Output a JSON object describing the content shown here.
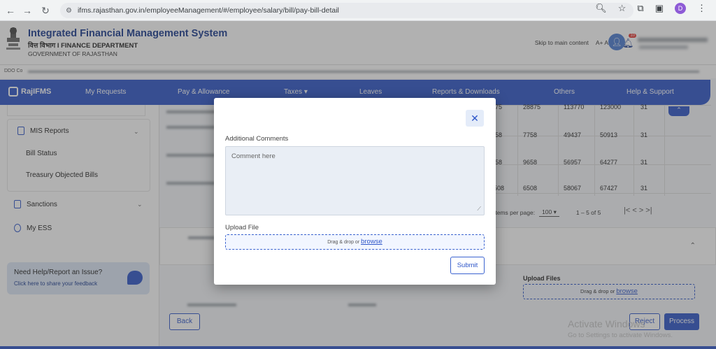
{
  "browser": {
    "url": "ifms.rajasthan.gov.in/employeeManagement/#/employee/salary/bill/pay-bill-detail",
    "profile_initial": "D"
  },
  "header": {
    "title": "Integrated Financial Management System",
    "department": "वित्त विभाग  I  FINANCE DEPARTMENT",
    "government": "GOVERNMENT OF RAJASTHAN",
    "skip_link": "Skip to main content",
    "font_controls": "A+  A  A-",
    "notification_count": "10",
    "ddo_label": "DDO Co"
  },
  "navbar": {
    "brand": "RajIFMS",
    "items": [
      "My Requests",
      "Pay & Allowance",
      "Taxes ▾",
      "Leaves",
      "Reports & Downloads",
      "Others",
      "Help & Support"
    ]
  },
  "sidebar": {
    "mis_reports": "MIS Reports",
    "bill_status": "Bill Status",
    "treasury_objected": "Treasury Objected Bills",
    "sanctions": "Sanctions",
    "my_ess": "My ESS",
    "help_title": "Need Help/Report an Issue?",
    "help_link": "Click here to share your feedback"
  },
  "table": {
    "rows": [
      [
        "75",
        "28875",
        "113770",
        "123000",
        "31"
      ],
      [
        "58",
        "7758",
        "49437",
        "50913",
        "31"
      ],
      [
        "58",
        "9658",
        "56957",
        "64277",
        "31"
      ],
      [
        "508",
        "6508",
        "58067",
        "67427",
        "31"
      ]
    ],
    "per_page_label": "Items per page:",
    "per_page_value": "100",
    "range": "1 – 5 of 5",
    "pager_icons": "|<   <   >   >|"
  },
  "main": {
    "upload_files_label": "Upload Files",
    "drag_drop": "Drag & drop or ",
    "browse": "browse",
    "back": "Back",
    "reject": "Reject",
    "process": "Process",
    "watermark_title": "Activate Windows",
    "watermark_sub": "Go to Settings to activate Windows."
  },
  "modal": {
    "comments_label": "Additional Comments",
    "comments_placeholder": "Comment here",
    "upload_label": "Upload File",
    "drag_drop": "Drag & drop or ",
    "browse": "browse",
    "submit": "Submit",
    "close_symbol": "✕"
  }
}
